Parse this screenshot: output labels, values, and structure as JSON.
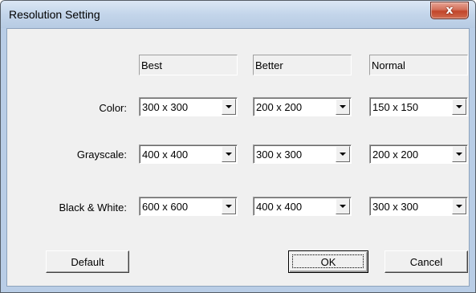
{
  "window": {
    "title": "Resolution Setting",
    "close_label": "x"
  },
  "columns": [
    "Best",
    "Better",
    "Normal"
  ],
  "rows": [
    {
      "label": "Color:",
      "values": [
        "300 x 300",
        "200 x 200",
        "150 x 150"
      ]
    },
    {
      "label": "Grayscale:",
      "values": [
        "400 x 400",
        "300 x 300",
        "200 x 200"
      ]
    },
    {
      "label": "Black & White:",
      "values": [
        "600 x 600",
        "400 x 400",
        "300 x 300"
      ]
    }
  ],
  "buttons": {
    "default_label": "Default",
    "ok_label": "OK",
    "cancel_label": "Cancel"
  }
}
